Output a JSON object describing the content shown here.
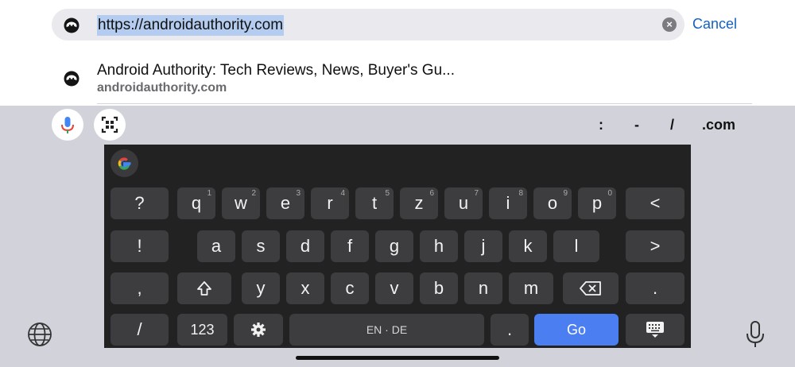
{
  "url_bar": {
    "url": "https://androidauthority.com",
    "cancel_label": "Cancel"
  },
  "suggestion": {
    "title": "Android Authority: Tech Reviews, News, Buyer's Gu...",
    "url": "androidauthority.com"
  },
  "shortcuts": [
    ":",
    "-",
    "/",
    ".com"
  ],
  "keyboard": {
    "row1": [
      {
        "label": "q",
        "sup": "1"
      },
      {
        "label": "w",
        "sup": "2"
      },
      {
        "label": "e",
        "sup": "3"
      },
      {
        "label": "r",
        "sup": "4"
      },
      {
        "label": "t",
        "sup": "5"
      },
      {
        "label": "z",
        "sup": "6"
      },
      {
        "label": "u",
        "sup": "7"
      },
      {
        "label": "i",
        "sup": "8"
      },
      {
        "label": "o",
        "sup": "9"
      },
      {
        "label": "p",
        "sup": "0"
      }
    ],
    "row2": [
      "a",
      "s",
      "d",
      "f",
      "g",
      "h",
      "j",
      "k",
      "l"
    ],
    "row3": [
      "y",
      "x",
      "c",
      "v",
      "b",
      "n",
      "m"
    ],
    "left_col": [
      "?",
      "!",
      ",",
      "/"
    ],
    "right_col": [
      "<",
      ">",
      "."
    ],
    "numbers_label": "123",
    "space_label": "EN · DE",
    "period_label": ".",
    "go_label": "Go"
  },
  "colors": {
    "accent": "#4b7ef0",
    "link": "#1560c0",
    "keyboard_bg": "#222222",
    "key_bg": "#3d3d3f"
  }
}
